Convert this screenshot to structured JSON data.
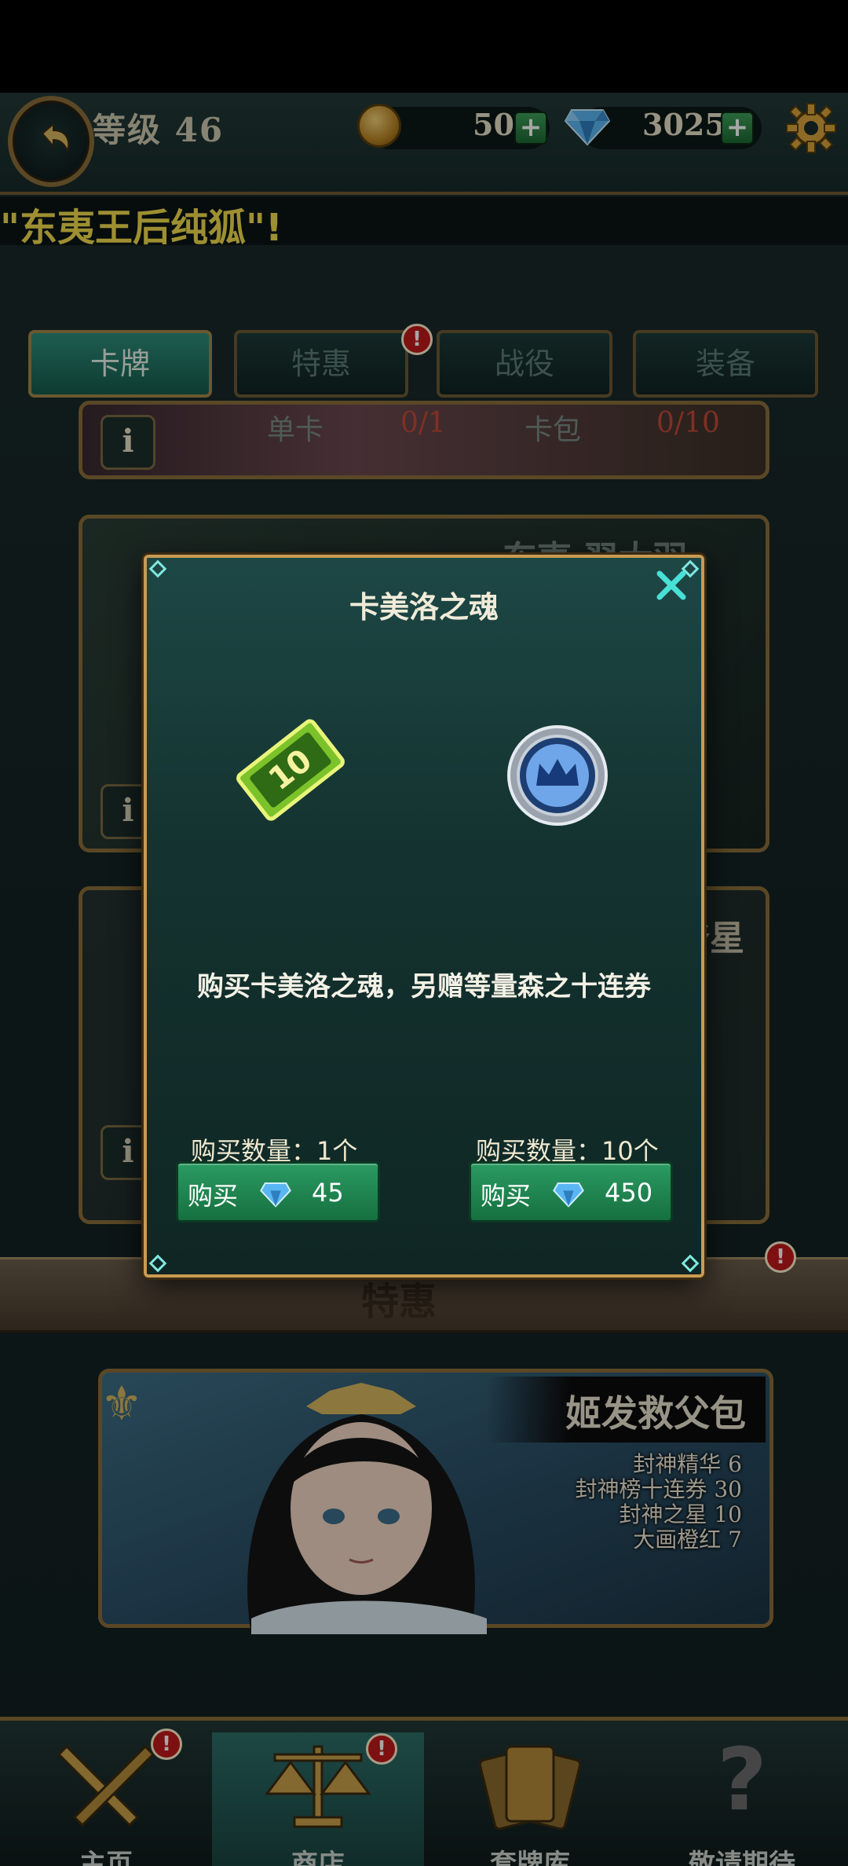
{
  "header": {
    "level_label": "等级 46",
    "gold": "50",
    "gems": "3025",
    "plus": "+"
  },
  "marquee": "\"东夷王后纯狐\"!",
  "tabs": [
    {
      "label": "卡牌",
      "active": true
    },
    {
      "label": "特惠",
      "badge": "!"
    },
    {
      "label": "战役"
    },
    {
      "label": "装备"
    }
  ],
  "background_cards": {
    "top_single": "单卡",
    "top_single_count": "0/1",
    "top_pack": "卡包",
    "top_pack_count": "0/10",
    "card_a_title": "东夷·羿大羽",
    "card_b_title": "森之最爷星",
    "info": "i"
  },
  "section_title": "特惠",
  "section_badge": "!",
  "pack": {
    "title": "姬发救父包",
    "items": [
      "封神精华 6",
      "封神榜十连券 30",
      "封神之星 10",
      "大画橙红 7"
    ]
  },
  "modal": {
    "title": "卡美洛之魂",
    "description": "购买卡美洛之魂，另赠等量森之十连券",
    "options": [
      {
        "qty_label": "购买数量：1个",
        "buy_label": "购买",
        "price": "45"
      },
      {
        "qty_label": "购买数量：10个",
        "buy_label": "购买",
        "price": "450"
      }
    ]
  },
  "nav": [
    {
      "label": "主页",
      "badge": "!"
    },
    {
      "label": "商店",
      "badge": "!",
      "active": true
    },
    {
      "label": "套牌库"
    },
    {
      "label": "敬请期待"
    }
  ],
  "colors": {
    "accent_gold": "#c89a53",
    "buy_green": "#2b9b63",
    "badge_red": "#c01919",
    "marquee_yellow": "#f2dc4e"
  }
}
